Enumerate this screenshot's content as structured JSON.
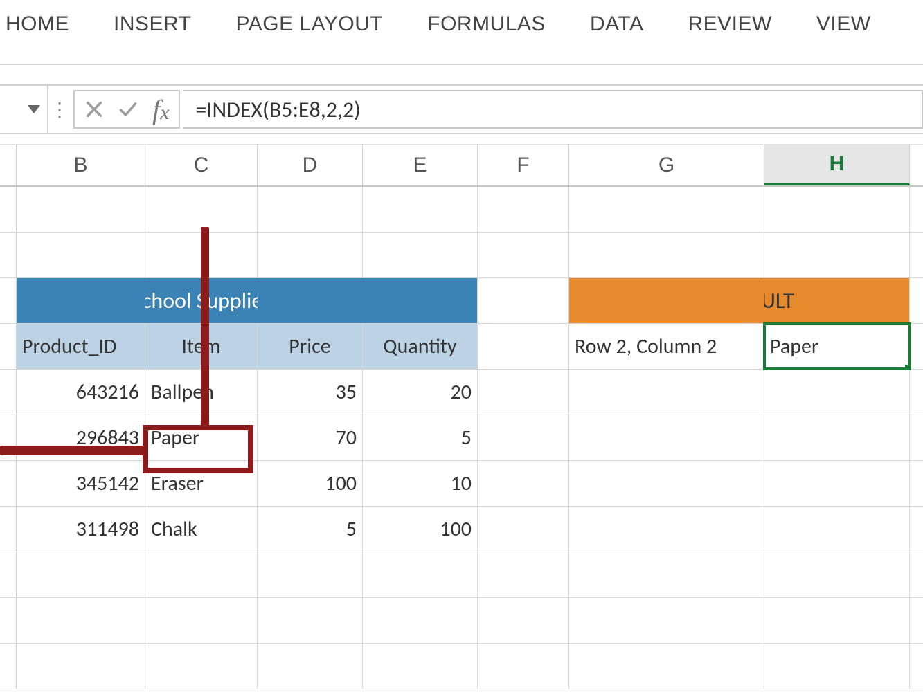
{
  "ribbon": {
    "tabs": [
      "HOME",
      "INSERT",
      "PAGE LAYOUT",
      "FORMULAS",
      "DATA",
      "REVIEW",
      "VIEW"
    ]
  },
  "formula_bar": {
    "formula": "=INDEX(B5:E8,2,2)"
  },
  "columns": [
    "B",
    "C",
    "D",
    "E",
    "F",
    "G",
    "H"
  ],
  "active_column": "H",
  "table": {
    "title": "School Supplies",
    "headers": [
      "Product_ID",
      "Item",
      "Price",
      "Quantity"
    ],
    "rows": [
      {
        "product_id": "643216",
        "item": "Ballpen",
        "price": "35",
        "qty": "20"
      },
      {
        "product_id": "296843",
        "item": "Paper",
        "price": "70",
        "qty": "5"
      },
      {
        "product_id": "345142",
        "item": "Eraser",
        "price": "100",
        "qty": "10"
      },
      {
        "product_id": "311498",
        "item": "Chalk",
        "price": "5",
        "qty": "100"
      }
    ]
  },
  "result": {
    "title": "RESULT",
    "label": "Row 2, Column 2",
    "value": "Paper"
  }
}
